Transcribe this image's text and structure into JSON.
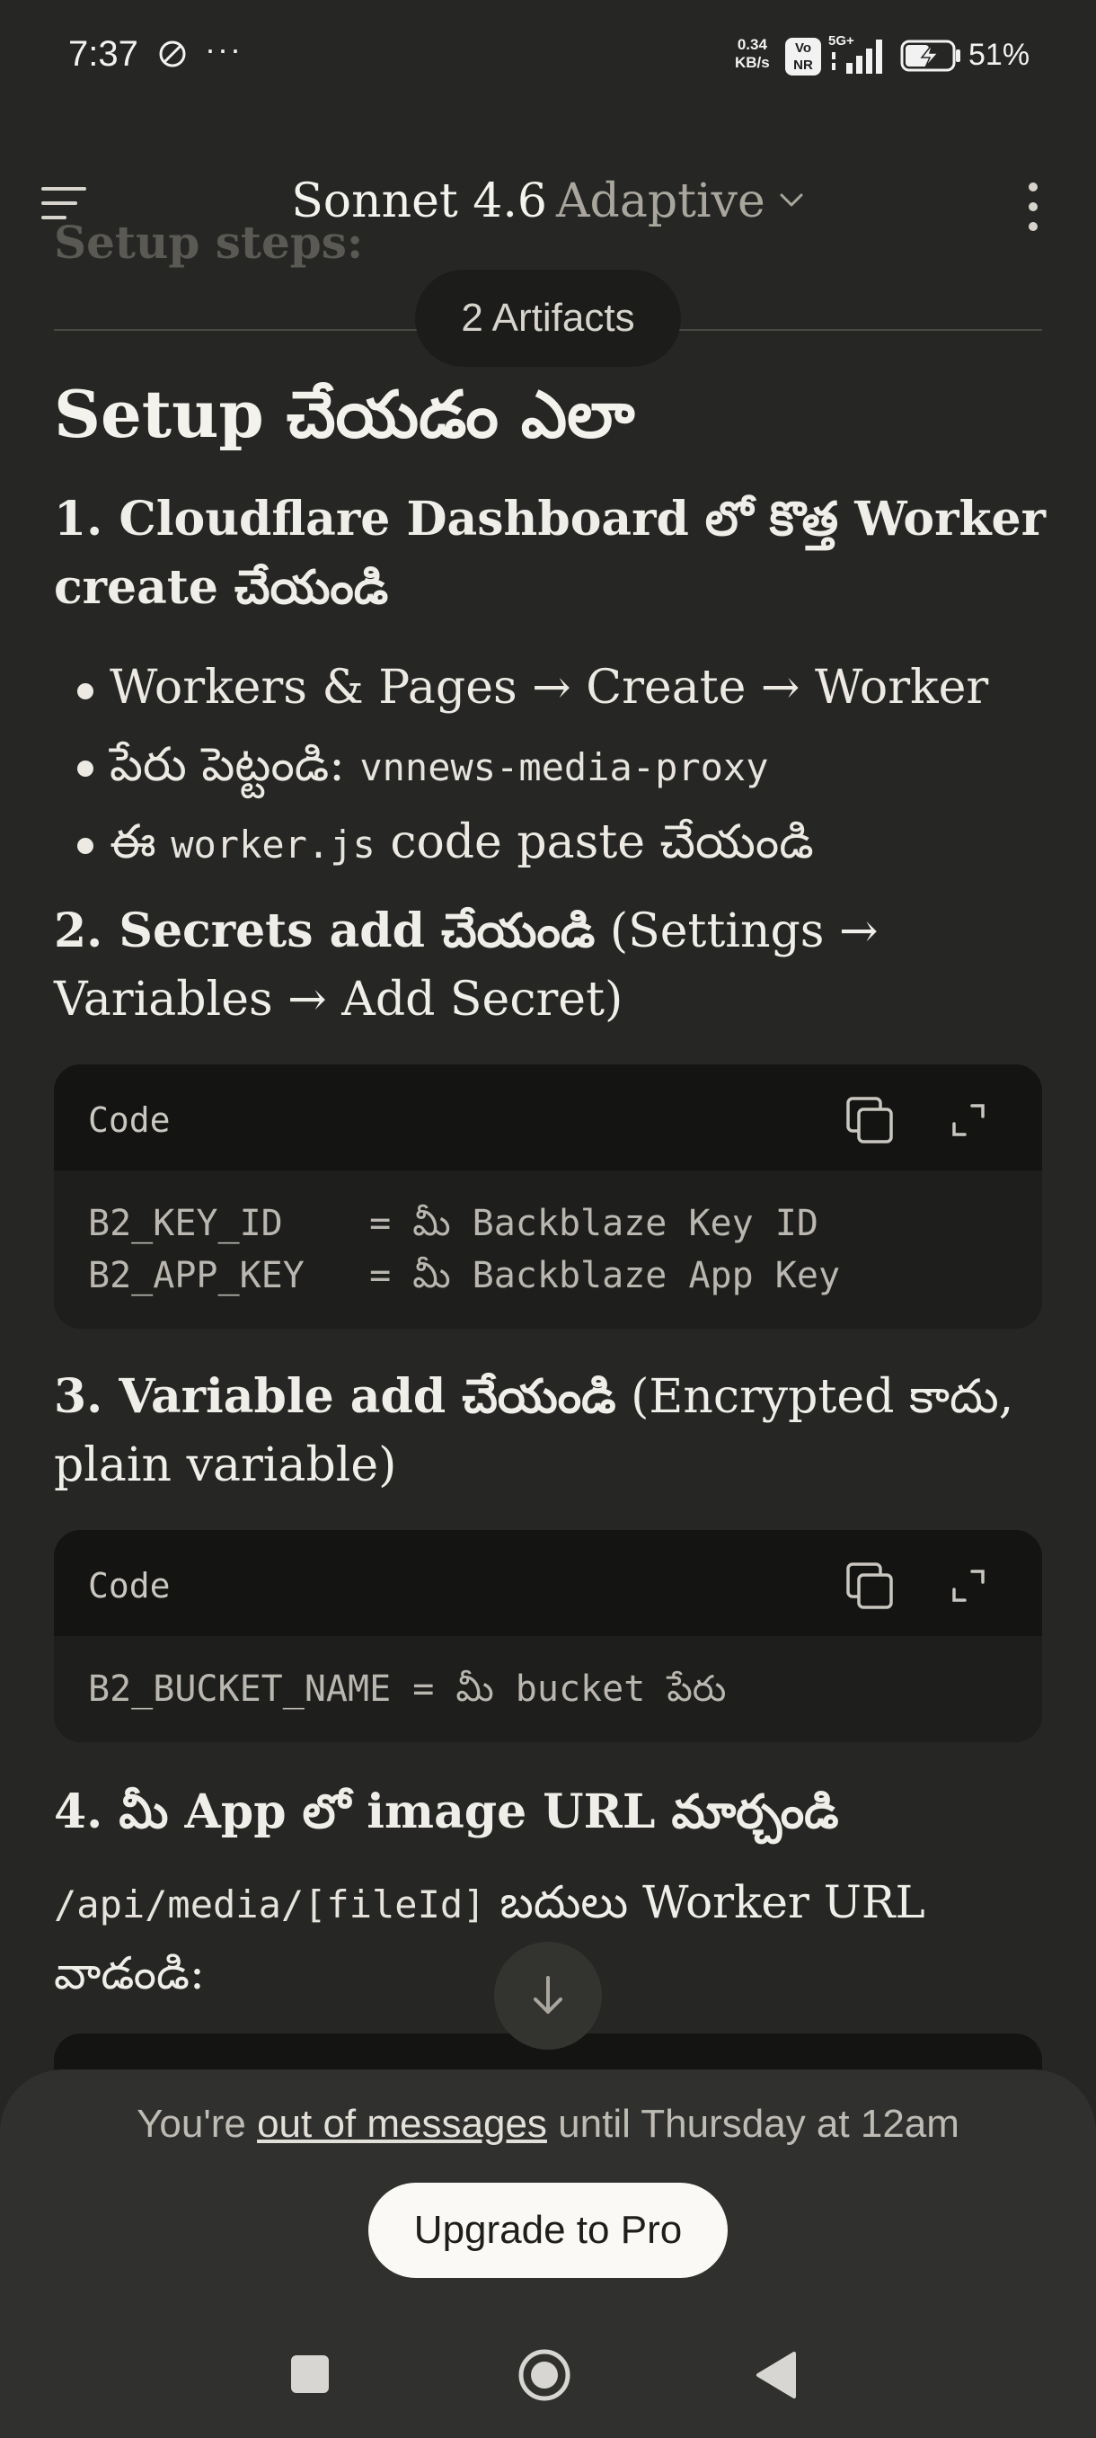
{
  "status_bar": {
    "time": "7:37",
    "more": "···",
    "speed_value": "0.34",
    "speed_unit": "KB/s",
    "volte_top": "Vo",
    "volte_bottom": "NR",
    "network": "5G+",
    "battery_percent": "51%"
  },
  "appbar": {
    "model_name": "Sonnet 4.6",
    "model_mode": "Adaptive"
  },
  "artifacts_pill": "2 Artifacts",
  "ghost_heading": "Setup steps:",
  "content": {
    "heading": "Setup చేయడం ఎలా",
    "step1": "1. Cloudflare Dashboard లో కొత్త Worker create చేయండి",
    "bullets": [
      {
        "text": "Workers & Pages → Create → Worker",
        "code": ""
      },
      {
        "text": "పేరు పెట్టండి: ",
        "code": "vnnews-media-proxy"
      },
      {
        "pre": "ఈ ",
        "code": "worker.js",
        "text": " code paste చేయండి"
      }
    ],
    "step2_bold": "2. Secrets add చేయండి",
    "step2_tail": " (Settings → Variables → Add Secret)",
    "code1": {
      "label": "Code",
      "body": "B2_KEY_ID    = మీ Backblaze Key ID\nB2_APP_KEY   = మీ Backblaze App Key"
    },
    "step3_bold": "3. Variable add చేయండి",
    "step3_tail": " (Encrypted కాదు, plain variable)",
    "code2": {
      "label": "Code",
      "body": "B2_BUCKET_NAME = మీ bucket పేరు"
    },
    "step4": "4. మీ App లో image URL మార్చండి",
    "step4_code": "/api/media/[fileId]",
    "step4_text": " బదులు Worker URL వాడండి:"
  },
  "bottom_sheet": {
    "prefix": "You're ",
    "link": "out of messages",
    "suffix": " until Thursday at 12am",
    "upgrade_label": "Upgrade to Pro"
  },
  "icons": {
    "menu": "menu-icon",
    "chevron": "chevron-down-icon",
    "kebab": "more-vert-icon",
    "copy": "copy-icon",
    "expand": "expand-icon",
    "scroll": "arrow-down-icon",
    "nav_recent": "recent-apps-icon",
    "nav_home": "home-icon",
    "nav_back": "back-icon"
  }
}
